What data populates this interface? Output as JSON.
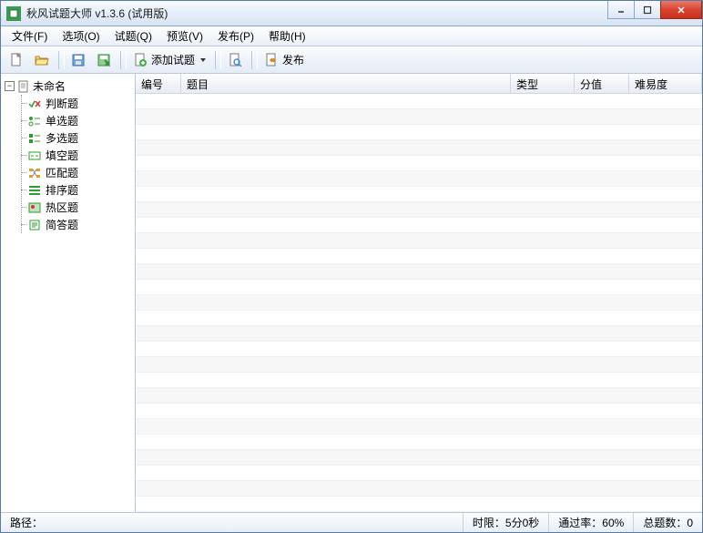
{
  "title": "秋风试题大师 v1.3.6 (试用版)",
  "menu": {
    "file": "文件(F)",
    "options": "选项(O)",
    "questions": "试题(Q)",
    "preview": "预览(V)",
    "publish": "发布(P)",
    "help": "帮助(H)"
  },
  "toolbar": {
    "add_question": "添加试题",
    "publish": "发布"
  },
  "tree": {
    "root": "未命名",
    "items": [
      {
        "label": "判断题"
      },
      {
        "label": "单选题"
      },
      {
        "label": "多选题"
      },
      {
        "label": "填空题"
      },
      {
        "label": "匹配题"
      },
      {
        "label": "排序题"
      },
      {
        "label": "热区题"
      },
      {
        "label": "简答题"
      }
    ]
  },
  "table": {
    "headers": {
      "number": "编号",
      "title": "题目",
      "type": "类型",
      "score": "分值",
      "difficulty": "难易度"
    }
  },
  "status": {
    "path_label": "路径：",
    "time_limit": "时限：5分0秒",
    "pass_rate": "通过率：60%",
    "total": "总题数：0"
  },
  "colors": {
    "close_button": "#d9442f",
    "titlebar_border": "#5a7aa0"
  }
}
